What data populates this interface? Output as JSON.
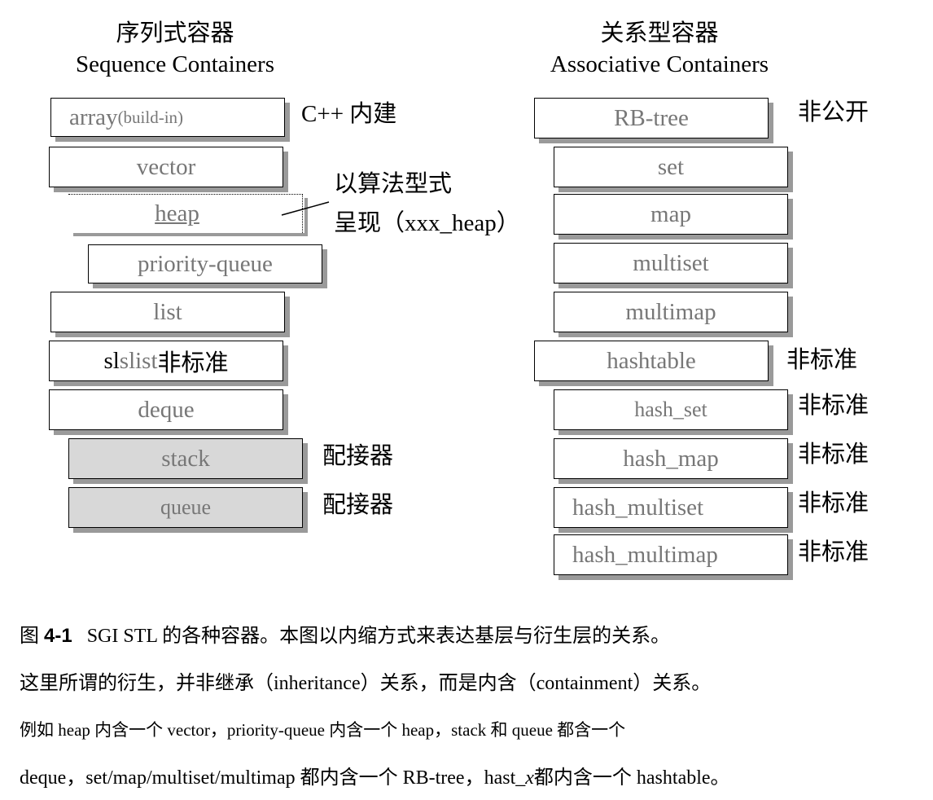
{
  "sequence": {
    "title_cn": "序列式容器",
    "title_en": "Sequence Containers",
    "array_main": "array",
    "array_suffix": "(build-in)",
    "array_note": "C++ 内建",
    "vector": "vector",
    "heap": "heap",
    "heap_note_line1": "以算法型式",
    "heap_note_line2": "呈现（xxx_heap）",
    "priority_queue": "priority-queue",
    "list": "list",
    "slist_prefix": "sl",
    "slist": "slist",
    "slist_note": "非标准",
    "deque": "deque",
    "stack": "stack",
    "stack_note": "配接器",
    "queue": "queue",
    "queue_note": "配接器"
  },
  "associative": {
    "title_cn": "关系型容器",
    "title_en": "Associative Containers",
    "rb_tree": "RB-tree",
    "rb_tree_note": "非公开",
    "set": "set",
    "map": "map",
    "multiset": "multiset",
    "multimap": "multimap",
    "hashtable": "hashtable",
    "hashtable_note": "非标准",
    "hash_set": "hash_set",
    "hash_set_note": "非标准",
    "hash_map": "hash_map",
    "hash_map_note": "非标准",
    "hash_multiset": "hash_multiset",
    "hash_multiset_note": "非标准",
    "hash_multimap": "hash_multimap",
    "hash_multimap_note": "非标准"
  },
  "caption": {
    "fig_prefix": "图 ",
    "fig_number": "4-1",
    "line1": "SGI STL  的各种容器。本图以内缩方式来表达基层与衍生层的关系。",
    "line2": "这里所谓的衍生，并非继承（inheritance）关系，而是内含（containment）关系。",
    "line3": "例如 heap 内含一个 vector，priority-queue 内含一个 heap，stack 和 queue 都含一个",
    "line4_a": "deque，set/map/multiset/multimap  都内含一个  RB-tree，hast_",
    "line4_x": "x",
    "line4_b": "都内含一个  hashtable。"
  }
}
